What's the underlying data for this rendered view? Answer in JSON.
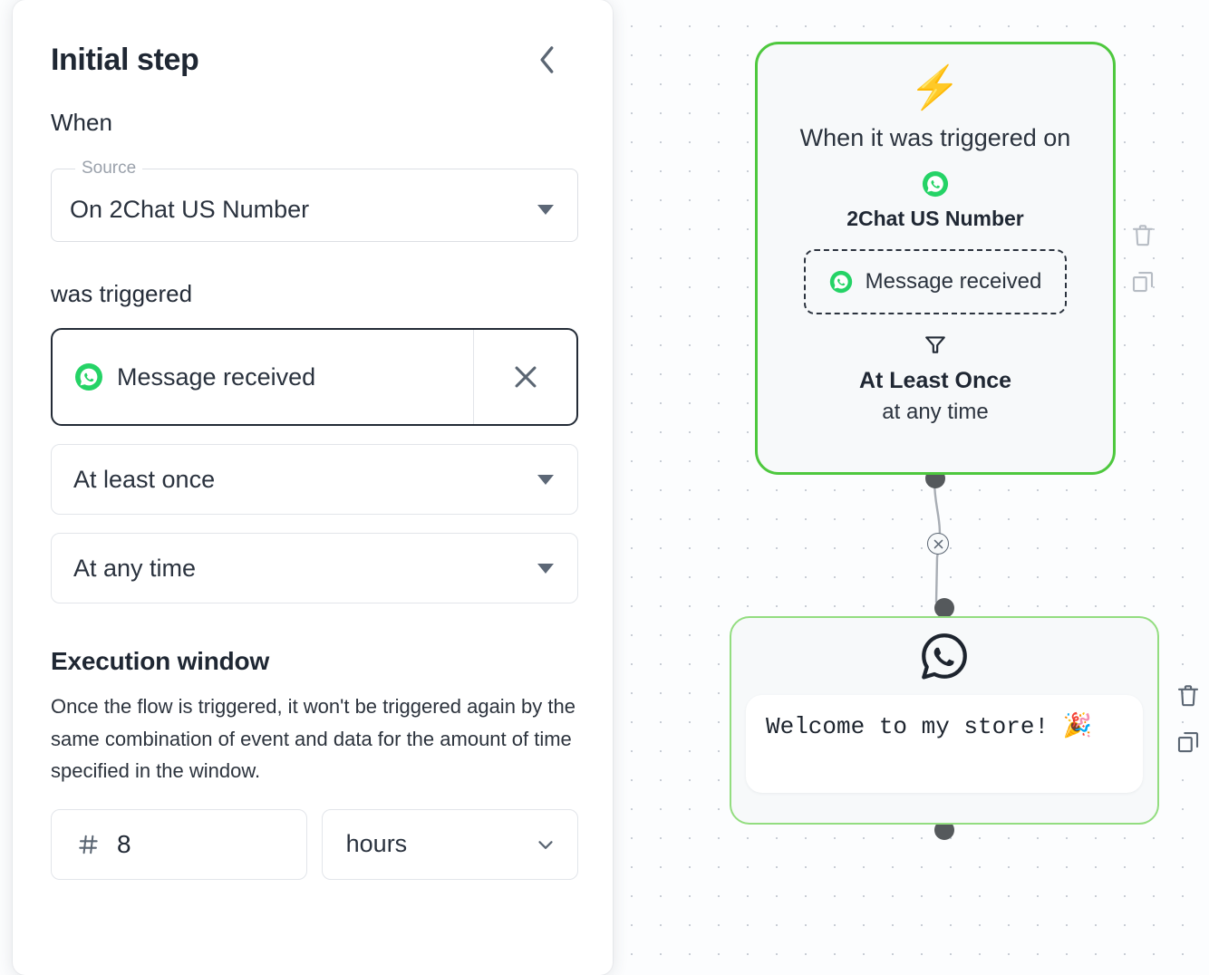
{
  "panel": {
    "title": "Initial step",
    "collapse_icon": "chevron-left-icon",
    "when_label": "When",
    "source": {
      "legend": "Source",
      "value": "On 2Chat US Number",
      "arrow_icon": "triangle-down-icon"
    },
    "was_triggered_label": "was triggered",
    "event": {
      "icon": "whatsapp-icon",
      "value": "Message received",
      "clear_icon": "close-icon"
    },
    "frequency_select": {
      "value": "At least once",
      "arrow_icon": "triangle-down-icon"
    },
    "time_select": {
      "value": "At any time",
      "arrow_icon": "triangle-down-icon"
    },
    "execution_window": {
      "title": "Execution window",
      "description": "Once the flow is triggered, it won't be triggered again by the same combination of event and data for the amount of time specified in the window.",
      "amount_icon": "hash-icon",
      "amount_value": "8",
      "unit_value": "hours",
      "unit_arrow_icon": "chevron-down-icon"
    }
  },
  "flow": {
    "trigger_node": {
      "bolt_icon": "⚡",
      "headline": "When it was triggered on",
      "channel_icon": "whatsapp-icon",
      "channel_name": "2Chat US Number",
      "event_chip": {
        "icon": "whatsapp-icon",
        "label": "Message received"
      },
      "filter_icon": "funnel-icon",
      "frequency": "At Least Once",
      "timing": "at any time",
      "border_color": "#4ec83e"
    },
    "message_node": {
      "icon": "whatsapp-outline-icon",
      "message_text": "Welcome to my store! 🎉",
      "border_color": "#93dd80"
    },
    "edge": {
      "delete_icon": "close-circle-icon"
    },
    "trigger_tools": [
      {
        "icon": "trash-icon",
        "name": "delete-trigger-node"
      },
      {
        "icon": "copy-icon",
        "name": "duplicate-trigger-node"
      }
    ],
    "message_tools": [
      {
        "icon": "trash-icon",
        "name": "delete-message-node"
      },
      {
        "icon": "copy-icon",
        "name": "duplicate-message-node"
      }
    ]
  },
  "colors": {
    "accent_green": "#4ec83e",
    "soft_green": "#93dd80",
    "text_dark": "#1f2733",
    "muted": "#9aa1ab"
  }
}
